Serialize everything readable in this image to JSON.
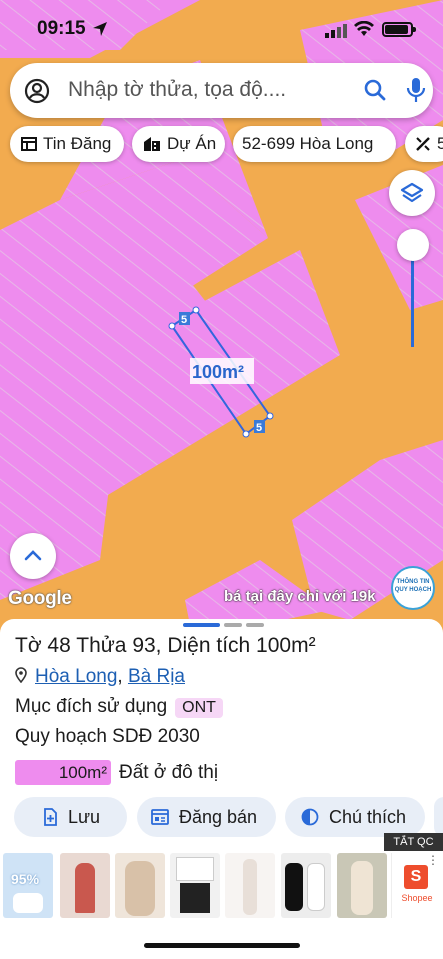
{
  "status_bar": {
    "time": "09:15"
  },
  "search": {
    "placeholder": "Nhập tờ thửa, tọa độ...."
  },
  "chips": [
    {
      "label": "Tin Đăng",
      "icon": "newspaper-icon"
    },
    {
      "label": "Dự Án",
      "icon": "building-icon"
    },
    {
      "label": "52-699 Hòa Long",
      "icon": ""
    },
    {
      "label": "5",
      "icon": "measure-icon"
    }
  ],
  "map": {
    "area_label": "100m²",
    "edge_labels": [
      "5",
      "5"
    ],
    "google_label": "Google",
    "ad_text": "bá tại đây chỉ với 19k",
    "logo_text": "THÔNG TIN QUY HOẠCH",
    "colors": {
      "road": "#f2ab4f",
      "land": "#ee8cee",
      "parcel_outline": "#3366dd"
    }
  },
  "sheet": {
    "title": "Tờ 48 Thửa 93, Diện tích 100m²",
    "ward": "Hòa Long",
    "separator": ",",
    "city": "Bà Rịa",
    "purpose_label": "Mục đích sử dụng",
    "purpose_code": "ONT",
    "plan_label": "Quy hoạch SDĐ 2030",
    "legend_area": "100m²",
    "legend_text": "Đất ở đô thị",
    "actions": [
      {
        "label": "Lưu",
        "icon": "bookmark-add-icon"
      },
      {
        "label": "Đăng bán",
        "icon": "listing-icon"
      },
      {
        "label": "Chú thích",
        "icon": "contrast-icon"
      }
    ]
  },
  "ads": {
    "close_label": "TẮT QC",
    "shopee_label": "Shopee",
    "shopee_letter": "S",
    "thumb_percent": "95%"
  }
}
